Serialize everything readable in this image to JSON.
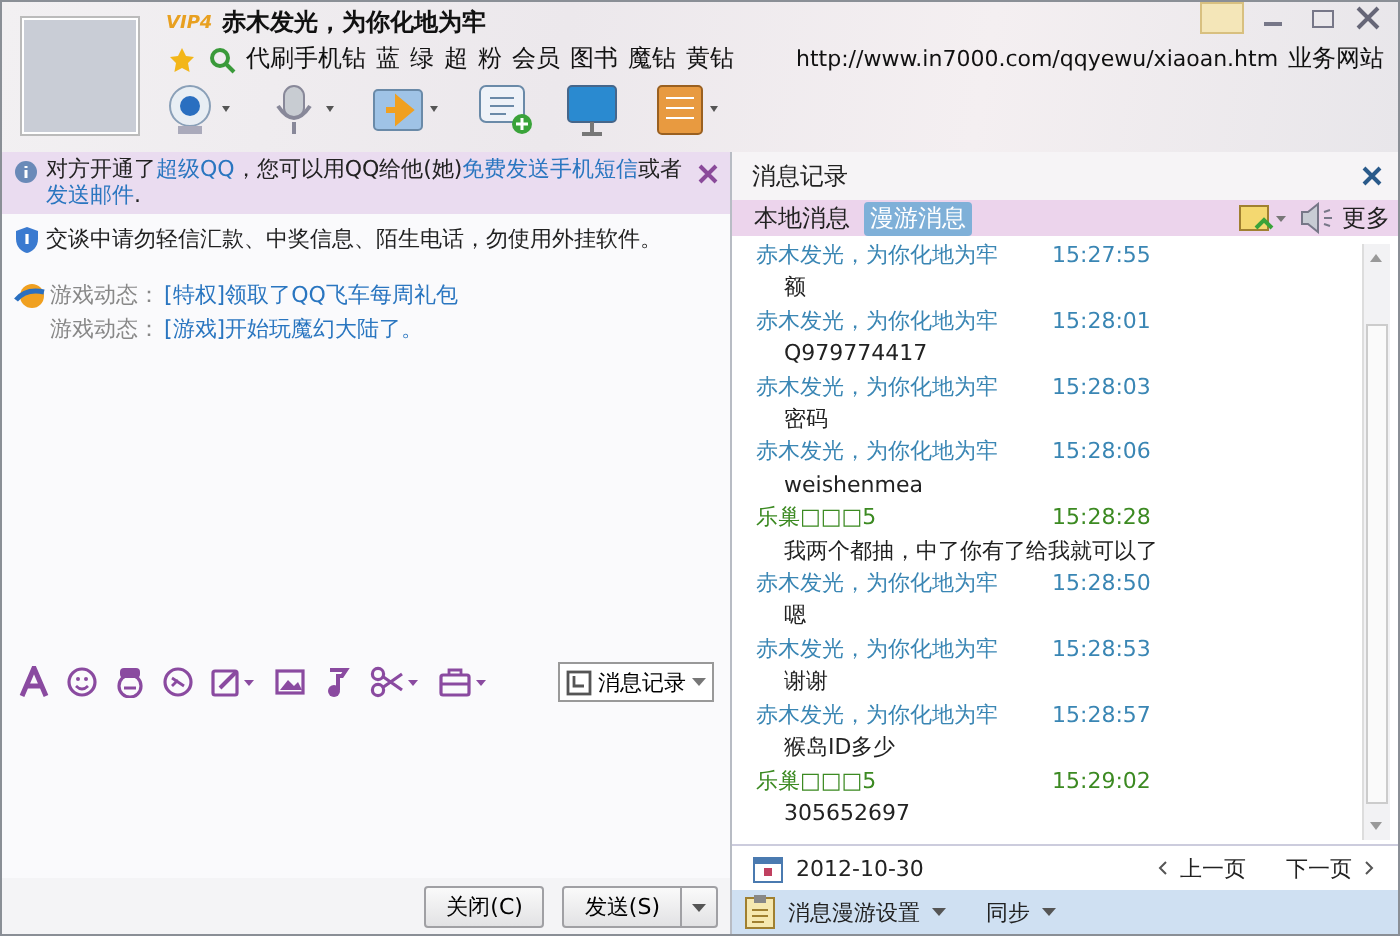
{
  "header": {
    "name": "赤木发光，为你化地为牢",
    "badge": "VIP4",
    "links": [
      "代刷手机钻",
      "蓝",
      "绿",
      "超",
      "粉",
      "会员",
      "图书",
      "魔钻",
      "黄钻"
    ],
    "url": "http://www.in7000.com/qqyewu/xiaoan.htm",
    "url_label": "业务网站"
  },
  "notice": {
    "parts": [
      {
        "text": "对方开通了",
        "link": false
      },
      {
        "text": "超级QQ",
        "link": true
      },
      {
        "text": "，您可以用QQ给他(她)",
        "link": false
      },
      {
        "text": "免费发送手机短信",
        "link": true
      },
      {
        "text": "或者",
        "link": false
      },
      {
        "text": "发送邮件",
        "link": true
      },
      {
        "text": ".",
        "link": false
      }
    ]
  },
  "warning": "交谈中请勿轻信汇款、中奖信息、陌生电话，勿使用外挂软件。",
  "games": [
    {
      "label": "游戏动态：",
      "text": "[特权]领取了QQ飞车每周礼包"
    },
    {
      "label": "游戏动态：",
      "text": "[游戏]开始玩魔幻大陆了。"
    }
  ],
  "history_button": "消息记录",
  "buttons": {
    "close": "关闭(C)",
    "send": "发送(S)"
  },
  "history": {
    "title": "消息记录",
    "tabs": [
      {
        "label": "本地消息",
        "selected": false
      },
      {
        "label": "漫游消息",
        "selected": true
      }
    ],
    "more": "更多",
    "messages": [
      {
        "sender": "赤木发光，为你化地为牢",
        "time": "15:27:55",
        "text": "额",
        "color": "#3a86b4"
      },
      {
        "sender": "赤木发光，为你化地为牢",
        "time": "15:28:01",
        "text": "Q979774417",
        "color": "#3a86b4"
      },
      {
        "sender": "赤木发光，为你化地为牢",
        "time": "15:28:03",
        "text": "密码",
        "color": "#3a86b4"
      },
      {
        "sender": "赤木发光，为你化地为牢",
        "time": "15:28:06",
        "text": "weishenmea",
        "color": "#3a86b4"
      },
      {
        "sender": "乐巢□□□5",
        "time": "15:28:28",
        "text": "我两个都抽，中了你有了给我就可以了",
        "color": "#3c8a22"
      },
      {
        "sender": "赤木发光，为你化地为牢",
        "time": "15:28:50",
        "text": "嗯",
        "color": "#3a86b4"
      },
      {
        "sender": "赤木发光，为你化地为牢",
        "time": "15:28:53",
        "text": "谢谢",
        "color": "#3a86b4"
      },
      {
        "sender": "赤木发光，为你化地为牢",
        "time": "15:28:57",
        "text": "猴岛ID多少",
        "color": "#3a86b4"
      },
      {
        "sender": "乐巢□□□5",
        "time": "15:29:02",
        "text": "305652697",
        "color": "#3c8a22"
      }
    ],
    "date": "2012-10-30",
    "prev": "上一页",
    "next": "下一页",
    "roam_settings": "消息漫游设置",
    "sync": "同步"
  }
}
